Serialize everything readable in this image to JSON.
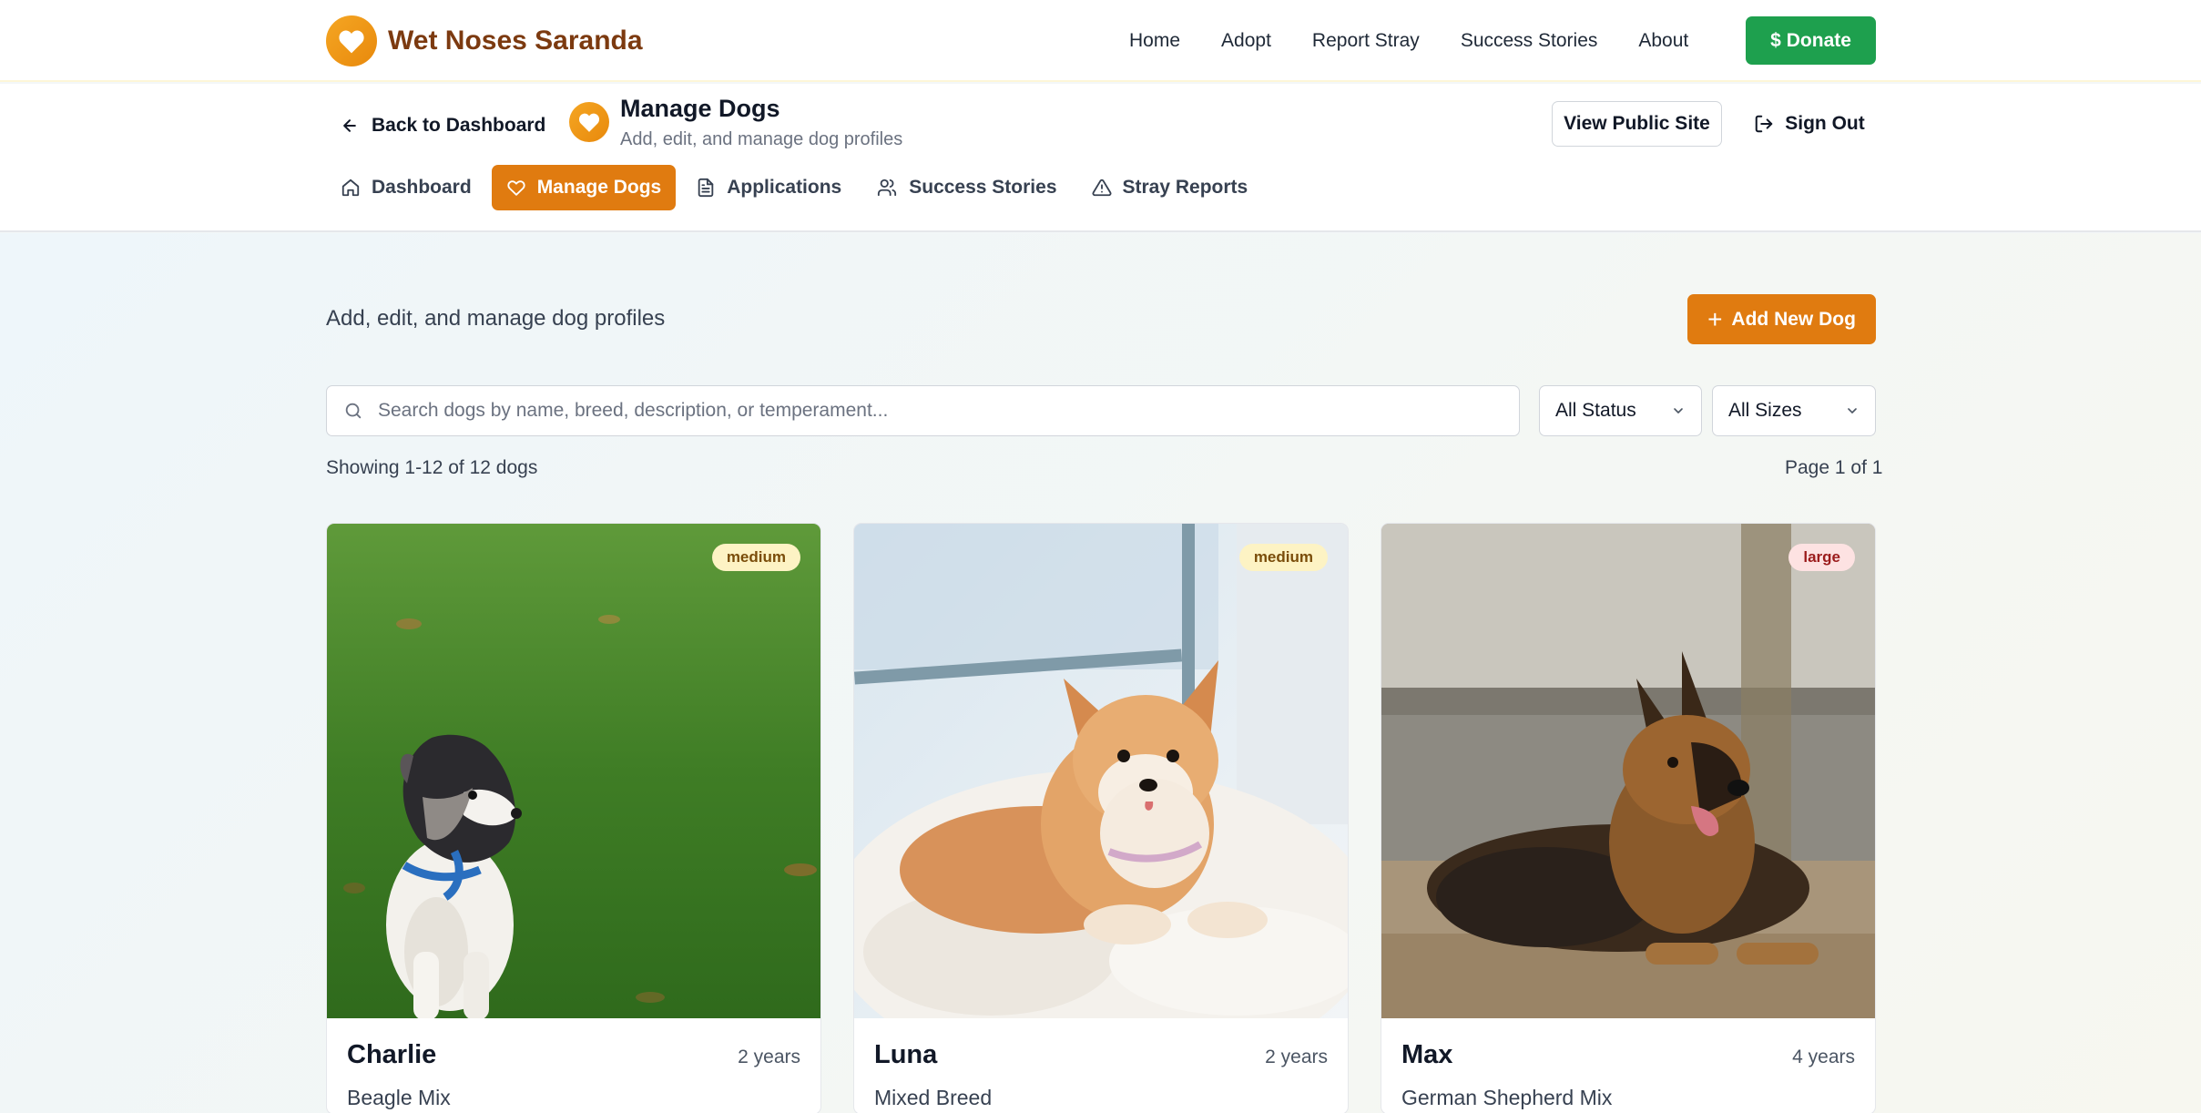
{
  "brand": {
    "name": "Wet Noses Saranda",
    "accent": "#e07b10",
    "logo_icon": "heart-icon"
  },
  "topnav": {
    "links": [
      "Home",
      "Adopt",
      "Report Stray",
      "Success Stories",
      "About"
    ],
    "donate_label": "Donate",
    "donate_color": "#1ea04e"
  },
  "admin": {
    "back_label": "Back to Dashboard",
    "page_title": "Manage Dogs",
    "page_subtitle": "Add, edit, and manage dog profiles",
    "view_public_label": "View Public Site",
    "signout_label": "Sign Out",
    "tabs": [
      {
        "label": "Dashboard",
        "icon": "home-icon",
        "active": false
      },
      {
        "label": "Manage Dogs",
        "icon": "heart-icon",
        "active": true
      },
      {
        "label": "Applications",
        "icon": "document-icon",
        "active": false
      },
      {
        "label": "Success Stories",
        "icon": "users-icon",
        "active": false
      },
      {
        "label": "Stray Reports",
        "icon": "alert-triangle-icon",
        "active": false
      }
    ]
  },
  "main": {
    "intro": "Add, edit, and manage dog profiles",
    "add_label": "Add New Dog",
    "search_placeholder": "Search dogs by name, breed, description, or temperament...",
    "search_value": "",
    "status_filter": "All Status",
    "size_filter": "All Sizes",
    "showing": "Showing 1-12 of 12 dogs",
    "page_info": "Page 1 of 1"
  },
  "dogs": [
    {
      "name": "Charlie",
      "age": "2 years",
      "breed": "Beagle Mix",
      "size": "medium"
    },
    {
      "name": "Luna",
      "age": "2 years",
      "breed": "Mixed Breed",
      "size": "medium"
    },
    {
      "name": "Max",
      "age": "4 years",
      "breed": "German Shepherd Mix",
      "size": "large"
    }
  ]
}
